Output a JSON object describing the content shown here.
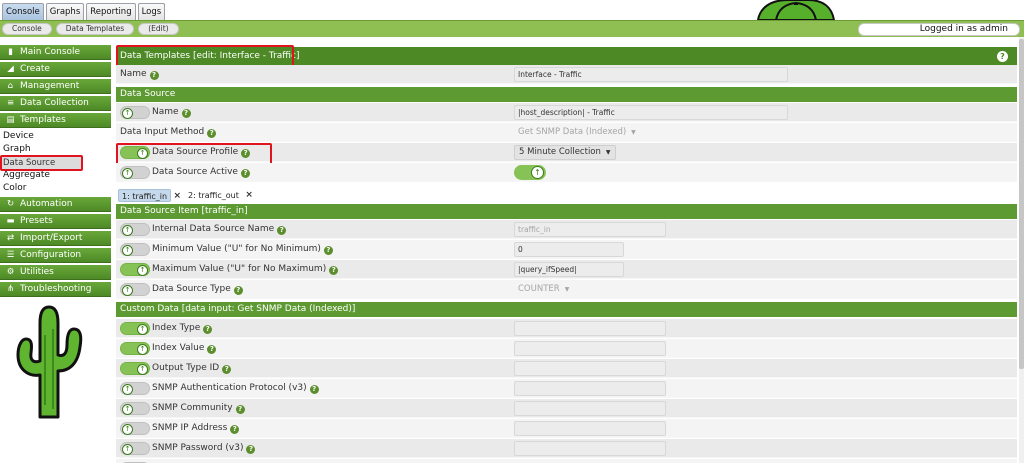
{
  "top_tabs": [
    "Console",
    "Graphs",
    "Reporting",
    "Logs"
  ],
  "breadcrumbs": [
    "Console",
    "Data Templates",
    "(Edit)"
  ],
  "login_text": "Logged in as admin",
  "sidebar": {
    "main_console": "Main Console",
    "create": "Create",
    "management": "Management",
    "data_collection": "Data Collection",
    "templates": "Templates",
    "template_items": [
      "Device",
      "Graph",
      "Data Source",
      "Aggregate",
      "Color"
    ],
    "automation": "Automation",
    "presets": "Presets",
    "import_export": "Import/Export",
    "configuration": "Configuration",
    "utilities": "Utilities",
    "troubleshooting": "Troubleshooting"
  },
  "page_header": "Data Templates [edit: Interface - Traffic]",
  "template_name": {
    "label": "Name",
    "value": "Interface - Traffic"
  },
  "data_source": {
    "header": "Data Source",
    "name_label": "Name",
    "name_value": "|host_description| - Traffic",
    "input_method_label": "Data Input Method",
    "input_method_value": "Get SNMP Data (Indexed)",
    "profile_label": "Data Source Profile",
    "profile_value": "5 Minute Collection",
    "active_label": "Data Source Active"
  },
  "item_tabs": [
    "1: traffic_in",
    "2: traffic_out"
  ],
  "ds_item": {
    "header": "Data Source Item [traffic_in]",
    "internal_name_label": "Internal Data Source Name",
    "internal_name_value": "traffic_in",
    "min_label": "Minimum Value (\"U\" for No Minimum)",
    "min_value": "0",
    "max_label": "Maximum Value (\"U\" for No Maximum)",
    "max_value": "|query_ifSpeed|",
    "type_label": "Data Source Type",
    "type_value": "COUNTER"
  },
  "custom_data": {
    "header": "Custom Data [data input: Get SNMP Data (Indexed)]",
    "fields": [
      "Index Type",
      "Index Value",
      "Output Type ID",
      "SNMP Authentication Protocol (v3)",
      "SNMP Community",
      "SNMP IP Address",
      "SNMP Password (v3)"
    ]
  },
  "colors": {
    "accent": "#4d8a26",
    "highlight": "#e0141e"
  }
}
